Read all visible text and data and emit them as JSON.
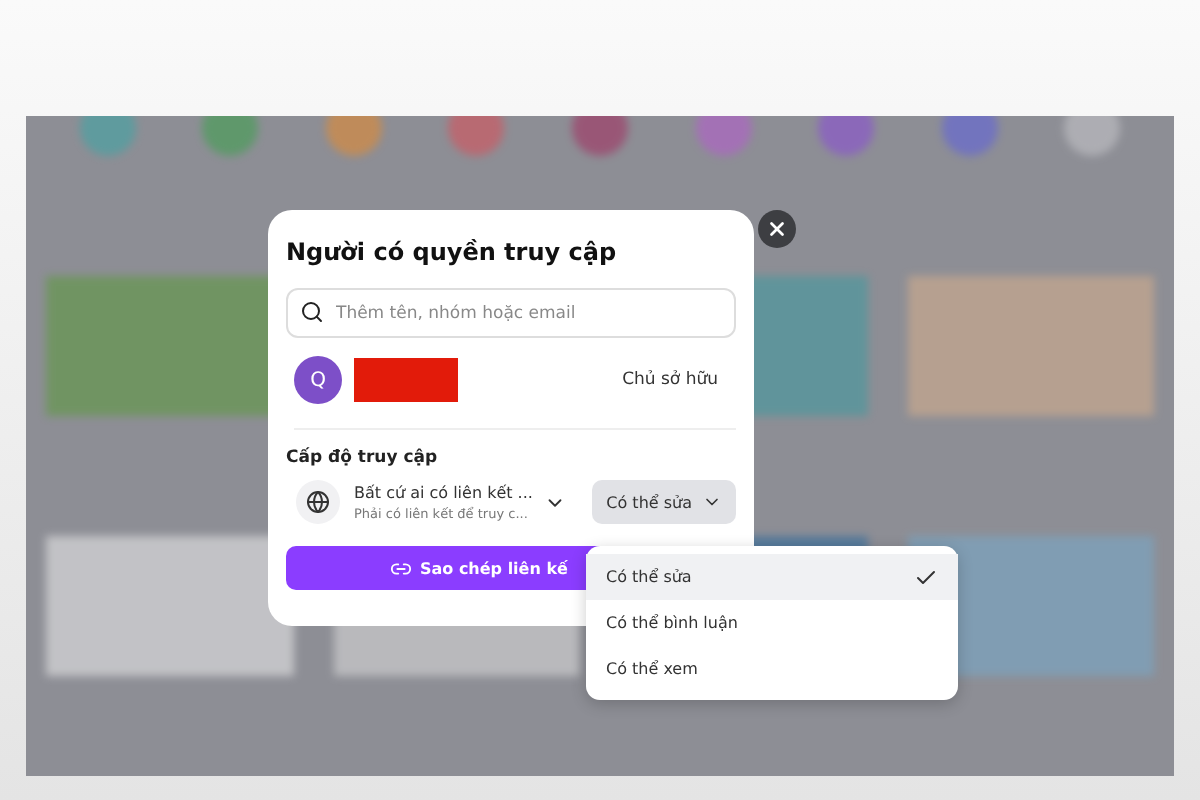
{
  "dialog": {
    "title": "Người có quyền truy cập",
    "search": {
      "placeholder": "Thêm tên, nhóm hoặc email"
    },
    "members": [
      {
        "avatar": "Q",
        "role": "Chủ sở hữu"
      }
    ],
    "access_heading": "Cấp độ truy cập",
    "link_access": {
      "title": "Bất cứ ai có liên kết ...",
      "subtitle": "Phải có liên kết để truy c..."
    },
    "permission": {
      "value": "Có thể sửa",
      "expanded": true
    },
    "copy_button": "Sao chép liên kế"
  },
  "permission_menu": [
    {
      "label": "Có thể sửa",
      "selected": true
    },
    {
      "label": "Có thể bình luận",
      "selected": false
    },
    {
      "label": "Có thể xem",
      "selected": false
    }
  ]
}
